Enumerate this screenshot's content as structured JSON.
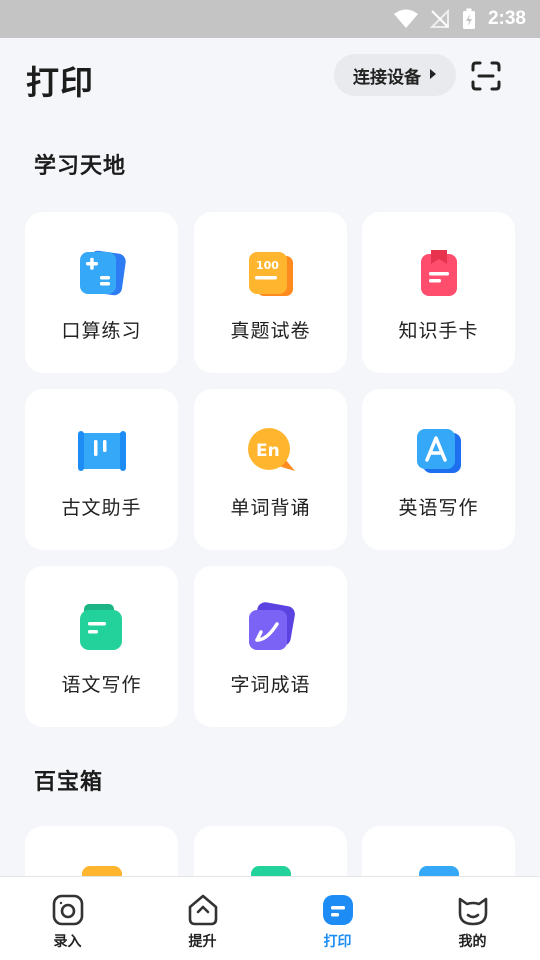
{
  "status_bar": {
    "time": "2:38"
  },
  "header": {
    "title": "打印",
    "connect_label": "连接设备"
  },
  "sections": [
    {
      "title": "学习天地"
    },
    {
      "title": "百宝箱"
    }
  ],
  "tools": [
    {
      "label": "口算练习",
      "icon": "calc-icon"
    },
    {
      "label": "真题试卷",
      "icon": "exam-paper-icon"
    },
    {
      "label": "知识手卡",
      "icon": "flashcard-icon"
    },
    {
      "label": "古文助手",
      "icon": "scroll-icon"
    },
    {
      "label": "单词背诵",
      "icon": "english-word-icon"
    },
    {
      "label": "英语写作",
      "icon": "english-writing-icon"
    },
    {
      "label": "语文写作",
      "icon": "chinese-writing-icon"
    },
    {
      "label": "字词成语",
      "icon": "idiom-icon"
    }
  ],
  "bottom_nav": [
    {
      "label": "录入",
      "icon": "camera-icon"
    },
    {
      "label": "提升",
      "icon": "improve-icon"
    },
    {
      "label": "打印",
      "icon": "print-icon",
      "active": true
    },
    {
      "label": "我的",
      "icon": "cat-face-icon"
    }
  ],
  "colors": {
    "accent": "#1d8df5",
    "background": "#f5f6fa"
  }
}
